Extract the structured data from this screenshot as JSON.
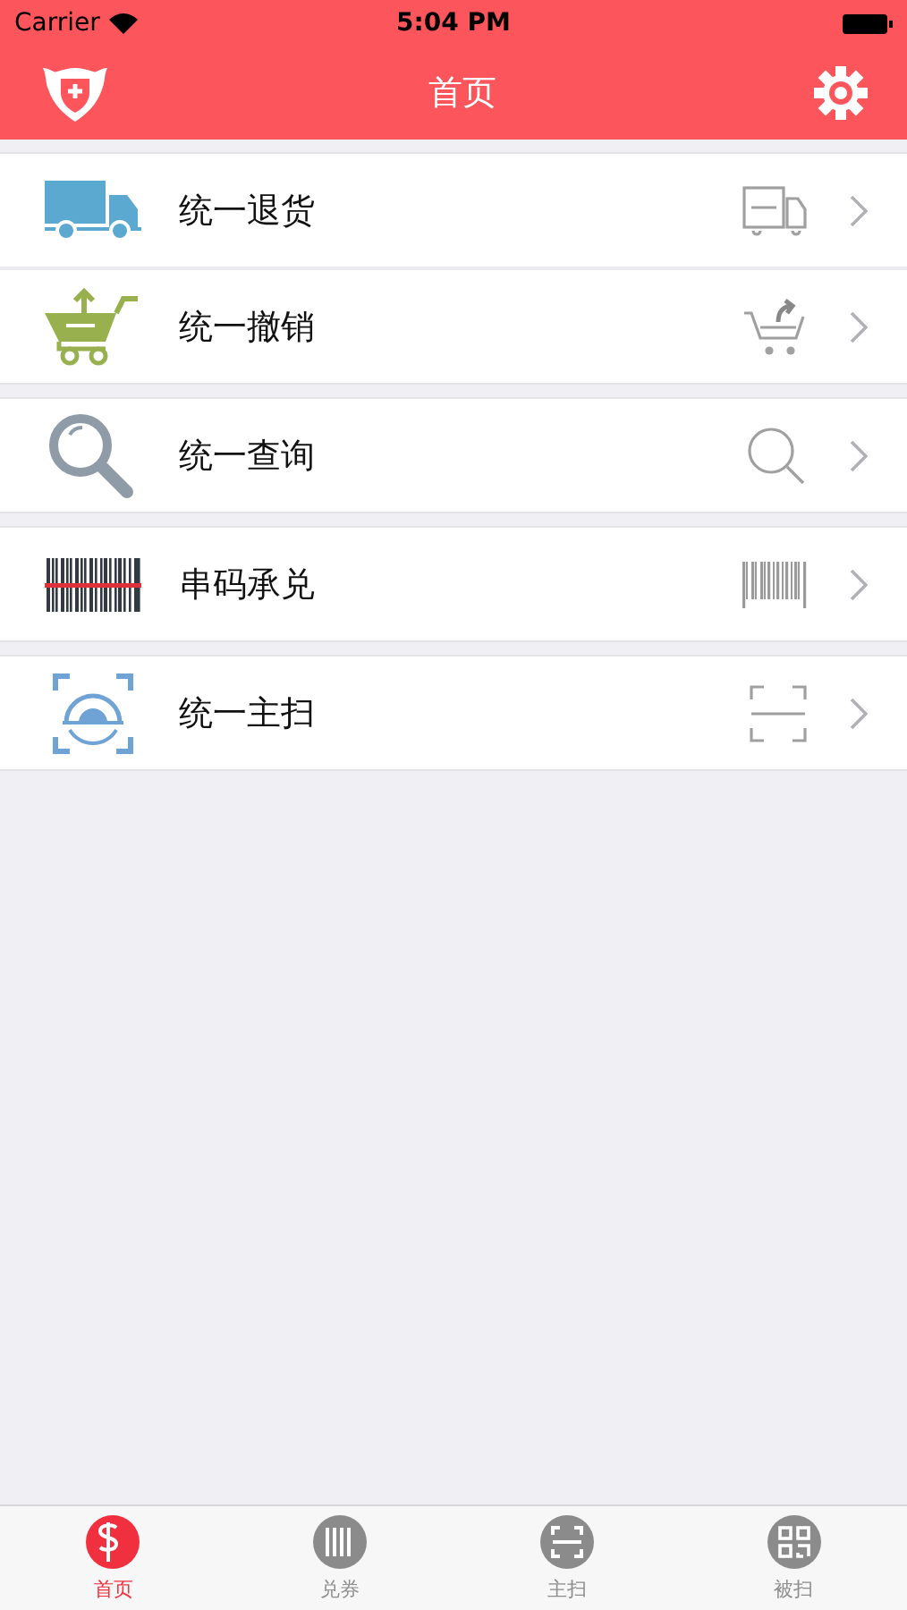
{
  "status_bar": {
    "carrier": "Carrier",
    "time": "5:04 PM"
  },
  "nav": {
    "title": "首页"
  },
  "groups": [
    {
      "items": [
        {
          "label": "统一退货",
          "kind": "truck"
        },
        {
          "label": "统一撤销",
          "kind": "cart"
        }
      ]
    },
    {
      "items": [
        {
          "label": "统一查询",
          "kind": "search"
        }
      ]
    },
    {
      "items": [
        {
          "label": "串码承兑",
          "kind": "barcode"
        }
      ]
    },
    {
      "items": [
        {
          "label": "统一主扫",
          "kind": "scan"
        }
      ]
    }
  ],
  "tabs": [
    {
      "label": "首页",
      "kind": "dollar",
      "selected": true
    },
    {
      "label": "兑券",
      "kind": "barcode",
      "selected": false
    },
    {
      "label": "主扫",
      "kind": "scan",
      "selected": false
    },
    {
      "label": "被扫",
      "kind": "qr",
      "selected": false
    }
  ]
}
